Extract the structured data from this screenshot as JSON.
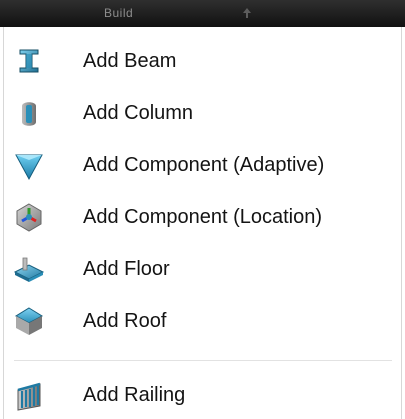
{
  "panel": {
    "title": "Build",
    "pin_icon": "pin-icon"
  },
  "menu": {
    "items": [
      {
        "label": "Add Beam",
        "icon": "beam-icon"
      },
      {
        "label": "Add Column",
        "icon": "column-icon"
      },
      {
        "label": "Add Component (Adaptive)",
        "icon": "adaptive-component-icon"
      },
      {
        "label": "Add Component (Location)",
        "icon": "location-component-icon"
      },
      {
        "label": "Add Floor",
        "icon": "floor-icon"
      },
      {
        "label": "Add Roof",
        "icon": "roof-icon"
      },
      {
        "label": "Add Railing",
        "icon": "railing-icon"
      }
    ]
  },
  "colors": {
    "titlebar": "#1a1a1a",
    "accent_blue": "#2a8fb8",
    "text": "#141414"
  }
}
